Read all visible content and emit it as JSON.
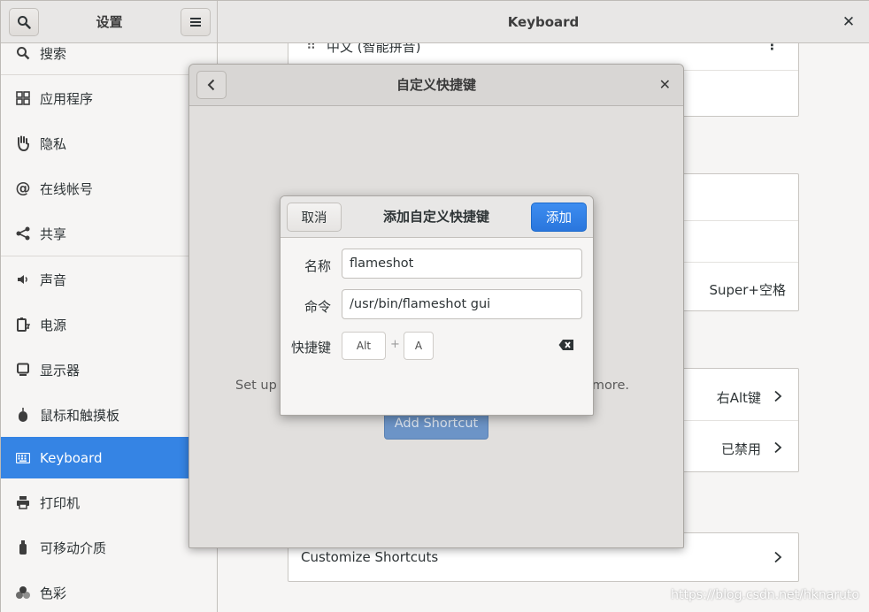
{
  "settings": {
    "sidebar_title": "设置",
    "panel_title": "Keyboard",
    "sidebar_items": [
      {
        "label": "搜索",
        "icon": "search-icon"
      },
      {
        "label": "应用程序",
        "icon": "grid-icon"
      },
      {
        "label": "隐私",
        "icon": "hand-icon"
      },
      {
        "label": "在线帐号",
        "icon": "at-icon"
      },
      {
        "label": "共享",
        "icon": "share-icon"
      },
      {
        "label": "声音",
        "icon": "speaker-icon"
      },
      {
        "label": "电源",
        "icon": "power-icon"
      },
      {
        "label": "显示器",
        "icon": "display-icon"
      },
      {
        "label": "鼠标和触摸板",
        "icon": "mouse-icon"
      },
      {
        "label": "Keyboard",
        "icon": "keyboard-icon",
        "active": true
      },
      {
        "label": "打印机",
        "icon": "printer-icon"
      },
      {
        "label": "可移动介质",
        "icon": "usb-drive-icon"
      },
      {
        "label": "色彩",
        "icon": "color-icon"
      }
    ]
  },
  "keyboard_panel": {
    "input_source": "中文 (智能拼音)",
    "special_char_value": "Super+空格",
    "alt_char_value": "右Alt键",
    "compose_value": "已禁用",
    "customize_shortcuts_label": "Customize Shortcuts"
  },
  "custom_shortcuts_dialog": {
    "title": "自定义快捷键",
    "description_left": "Set up c",
    "description_right": "d more.",
    "add_button_label": "Add Shortcut"
  },
  "add_shortcut_dialog": {
    "cancel_label": "取消",
    "title": "添加自定义快捷键",
    "add_label": "添加",
    "name_label": "名称",
    "name_value": "flameshot",
    "command_label": "命令",
    "command_value": "/usr/bin/flameshot gui",
    "shortcut_label": "快捷键",
    "keys": [
      "Alt",
      "A"
    ],
    "plus": "+"
  },
  "watermark": "https://blog.csdn.net/hknaruto",
  "colors": {
    "accent": "#3584e4",
    "header": "#e8e7e6",
    "background": "#f6f5f4"
  }
}
